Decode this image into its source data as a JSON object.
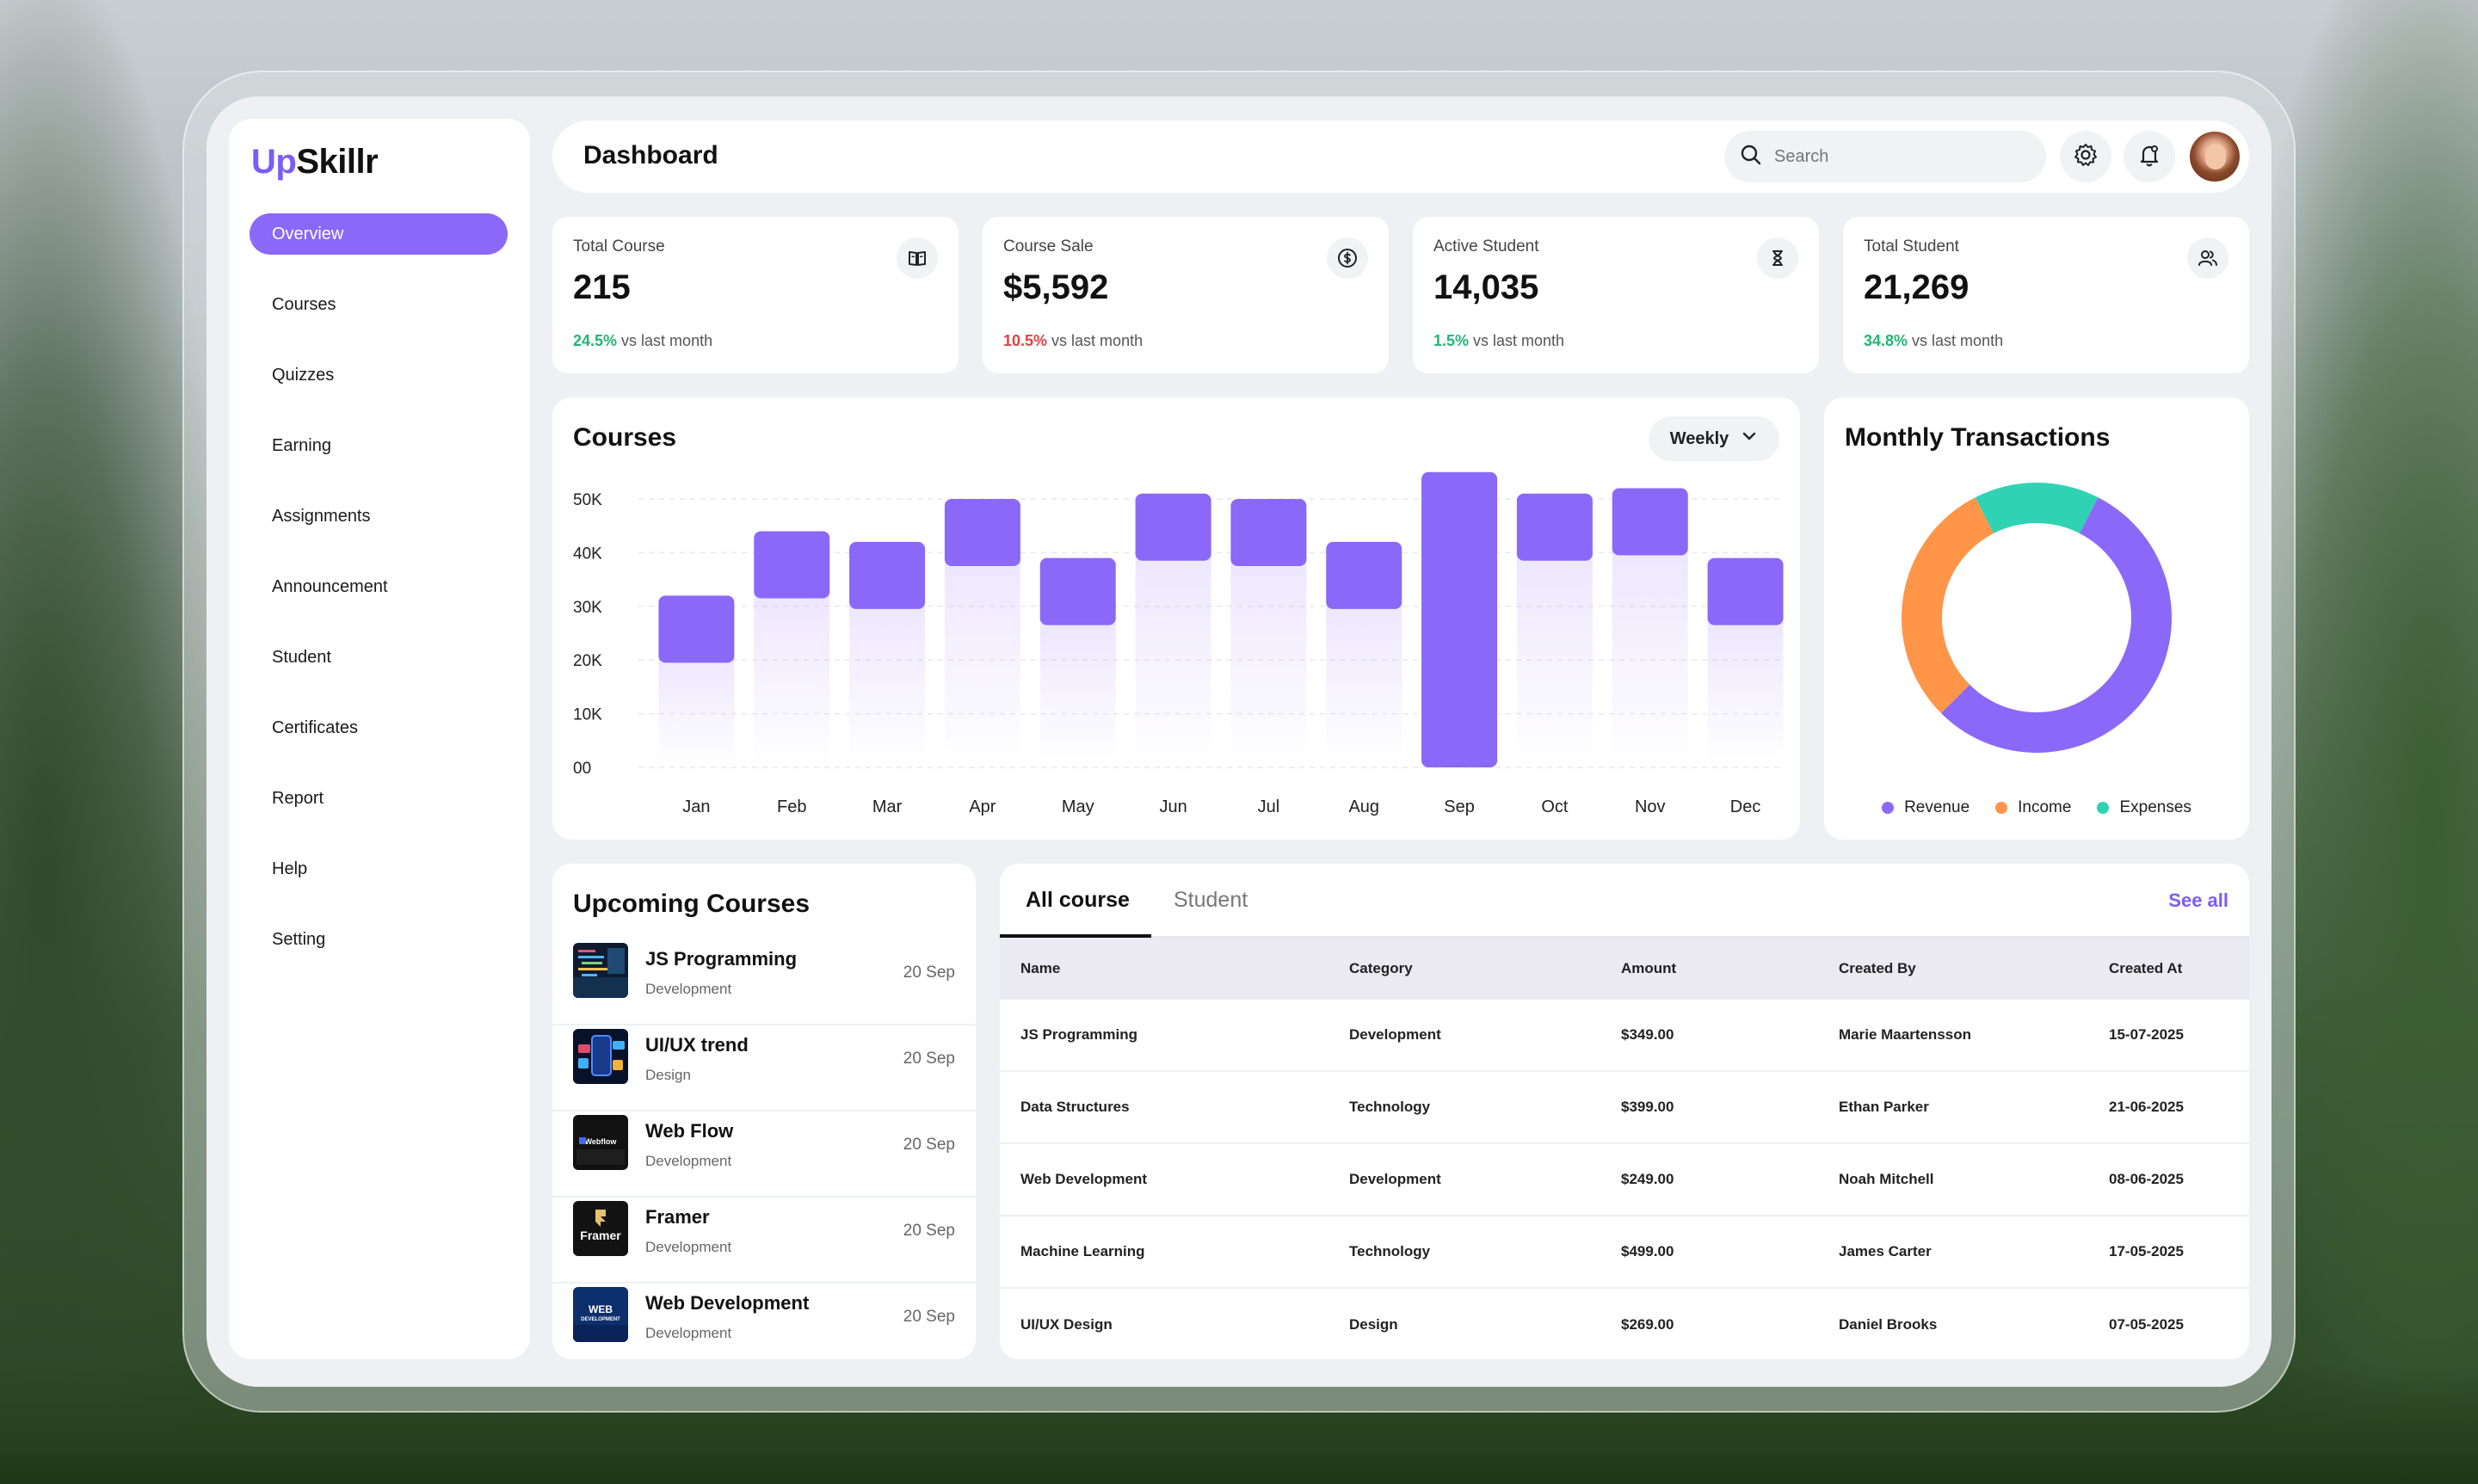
{
  "brand": {
    "prefix": "Up",
    "suffix": "Skillr",
    "accent": "#7b5cf5"
  },
  "nav": {
    "items": [
      {
        "label": "Overview",
        "active": true
      },
      {
        "label": "Courses"
      },
      {
        "label": "Quizzes"
      },
      {
        "label": "Earning"
      },
      {
        "label": "Assignments"
      },
      {
        "label": "Announcement"
      },
      {
        "label": "Student"
      },
      {
        "label": "Certificates"
      },
      {
        "label": "Report"
      },
      {
        "label": "Help"
      },
      {
        "label": "Setting"
      }
    ]
  },
  "header": {
    "title": "Dashboard",
    "search_placeholder": "Search",
    "icons": [
      "search-icon",
      "gear-icon",
      "bell-icon"
    ]
  },
  "stats": [
    {
      "label": "Total Course",
      "value": "215",
      "delta": "24.5%",
      "delta_text": " vs last month",
      "trend": "up",
      "icon": "book-icon"
    },
    {
      "label": "Course Sale",
      "value": "$5,592",
      "delta": "10.5%",
      "delta_text": " vs last month",
      "trend": "down",
      "icon": "dollar-icon"
    },
    {
      "label": "Active Student",
      "value": "14,035",
      "delta": "1.5%",
      "delta_text": " vs last month",
      "trend": "up",
      "icon": "hourglass-icon"
    },
    {
      "label": "Total Student",
      "value": "21,269",
      "delta": "34.8%",
      "delta_text": " vs last month",
      "trend": "up",
      "icon": "users-icon"
    }
  ],
  "courses_card": {
    "title": "Courses",
    "period": "Weekly"
  },
  "chart_data": {
    "type": "bar",
    "title": "Courses",
    "categories": [
      "Jan",
      "Feb",
      "Mar",
      "Apr",
      "May",
      "Jun",
      "Jul",
      "Aug",
      "Sep",
      "Oct",
      "Nov",
      "Dec"
    ],
    "values": [
      32000,
      44000,
      42000,
      50000,
      39000,
      51000,
      50000,
      42000,
      55000,
      51000,
      52000,
      39000
    ],
    "y_ticks": [
      "00",
      "10K",
      "20K",
      "30K",
      "40K",
      "50K"
    ],
    "ylim": [
      0,
      50000
    ],
    "bar_color": "#8b68f8",
    "grid": true
  },
  "transactions": {
    "title": "Monthly Transactions",
    "chart_data": {
      "type": "pie",
      "labels": [
        "Revenue",
        "Income",
        "Expenses"
      ],
      "values": [
        55,
        30,
        15
      ],
      "colors": [
        "#8b68f8",
        "#ff9548",
        "#2fd3b3"
      ]
    }
  },
  "upcoming": {
    "title": "Upcoming Courses",
    "items": [
      {
        "name": "JS Programming",
        "category": "Development",
        "date": "20 Sep"
      },
      {
        "name": "UI/UX trend",
        "category": "Design",
        "date": "20 Sep"
      },
      {
        "name": "Web Flow",
        "category": "Development",
        "date": "20 Sep"
      },
      {
        "name": "Framer",
        "category": "Development",
        "date": "20 Sep"
      },
      {
        "name": "Web Development",
        "category": "Development",
        "date": "20 Sep"
      }
    ],
    "thumb_texts": {
      "webflow": "Webflow",
      "framer": "Framer",
      "webdev_1": "WEB",
      "webdev_2": "DEVELOPMENT"
    }
  },
  "table": {
    "tabs": [
      "All course",
      "Student"
    ],
    "see_all": "See all",
    "columns": [
      "Name",
      "Category",
      "Amount",
      "Created By",
      "Created At"
    ],
    "rows": [
      [
        "JS Programming",
        "Development",
        "$349.00",
        "Marie Maartensson",
        "15-07-2025"
      ],
      [
        "Data Structures",
        "Technology",
        "$399.00",
        "Ethan Parker",
        "21-06-2025"
      ],
      [
        "Web Development",
        "Development",
        "$249.00",
        "Noah Mitchell",
        "08-06-2025"
      ],
      [
        "Machine Learning",
        "Technology",
        "$499.00",
        "James Carter",
        "17-05-2025"
      ],
      [
        "UI/UX Design",
        "Design",
        "$269.00",
        "Daniel Brooks",
        "07-05-2025"
      ]
    ]
  }
}
